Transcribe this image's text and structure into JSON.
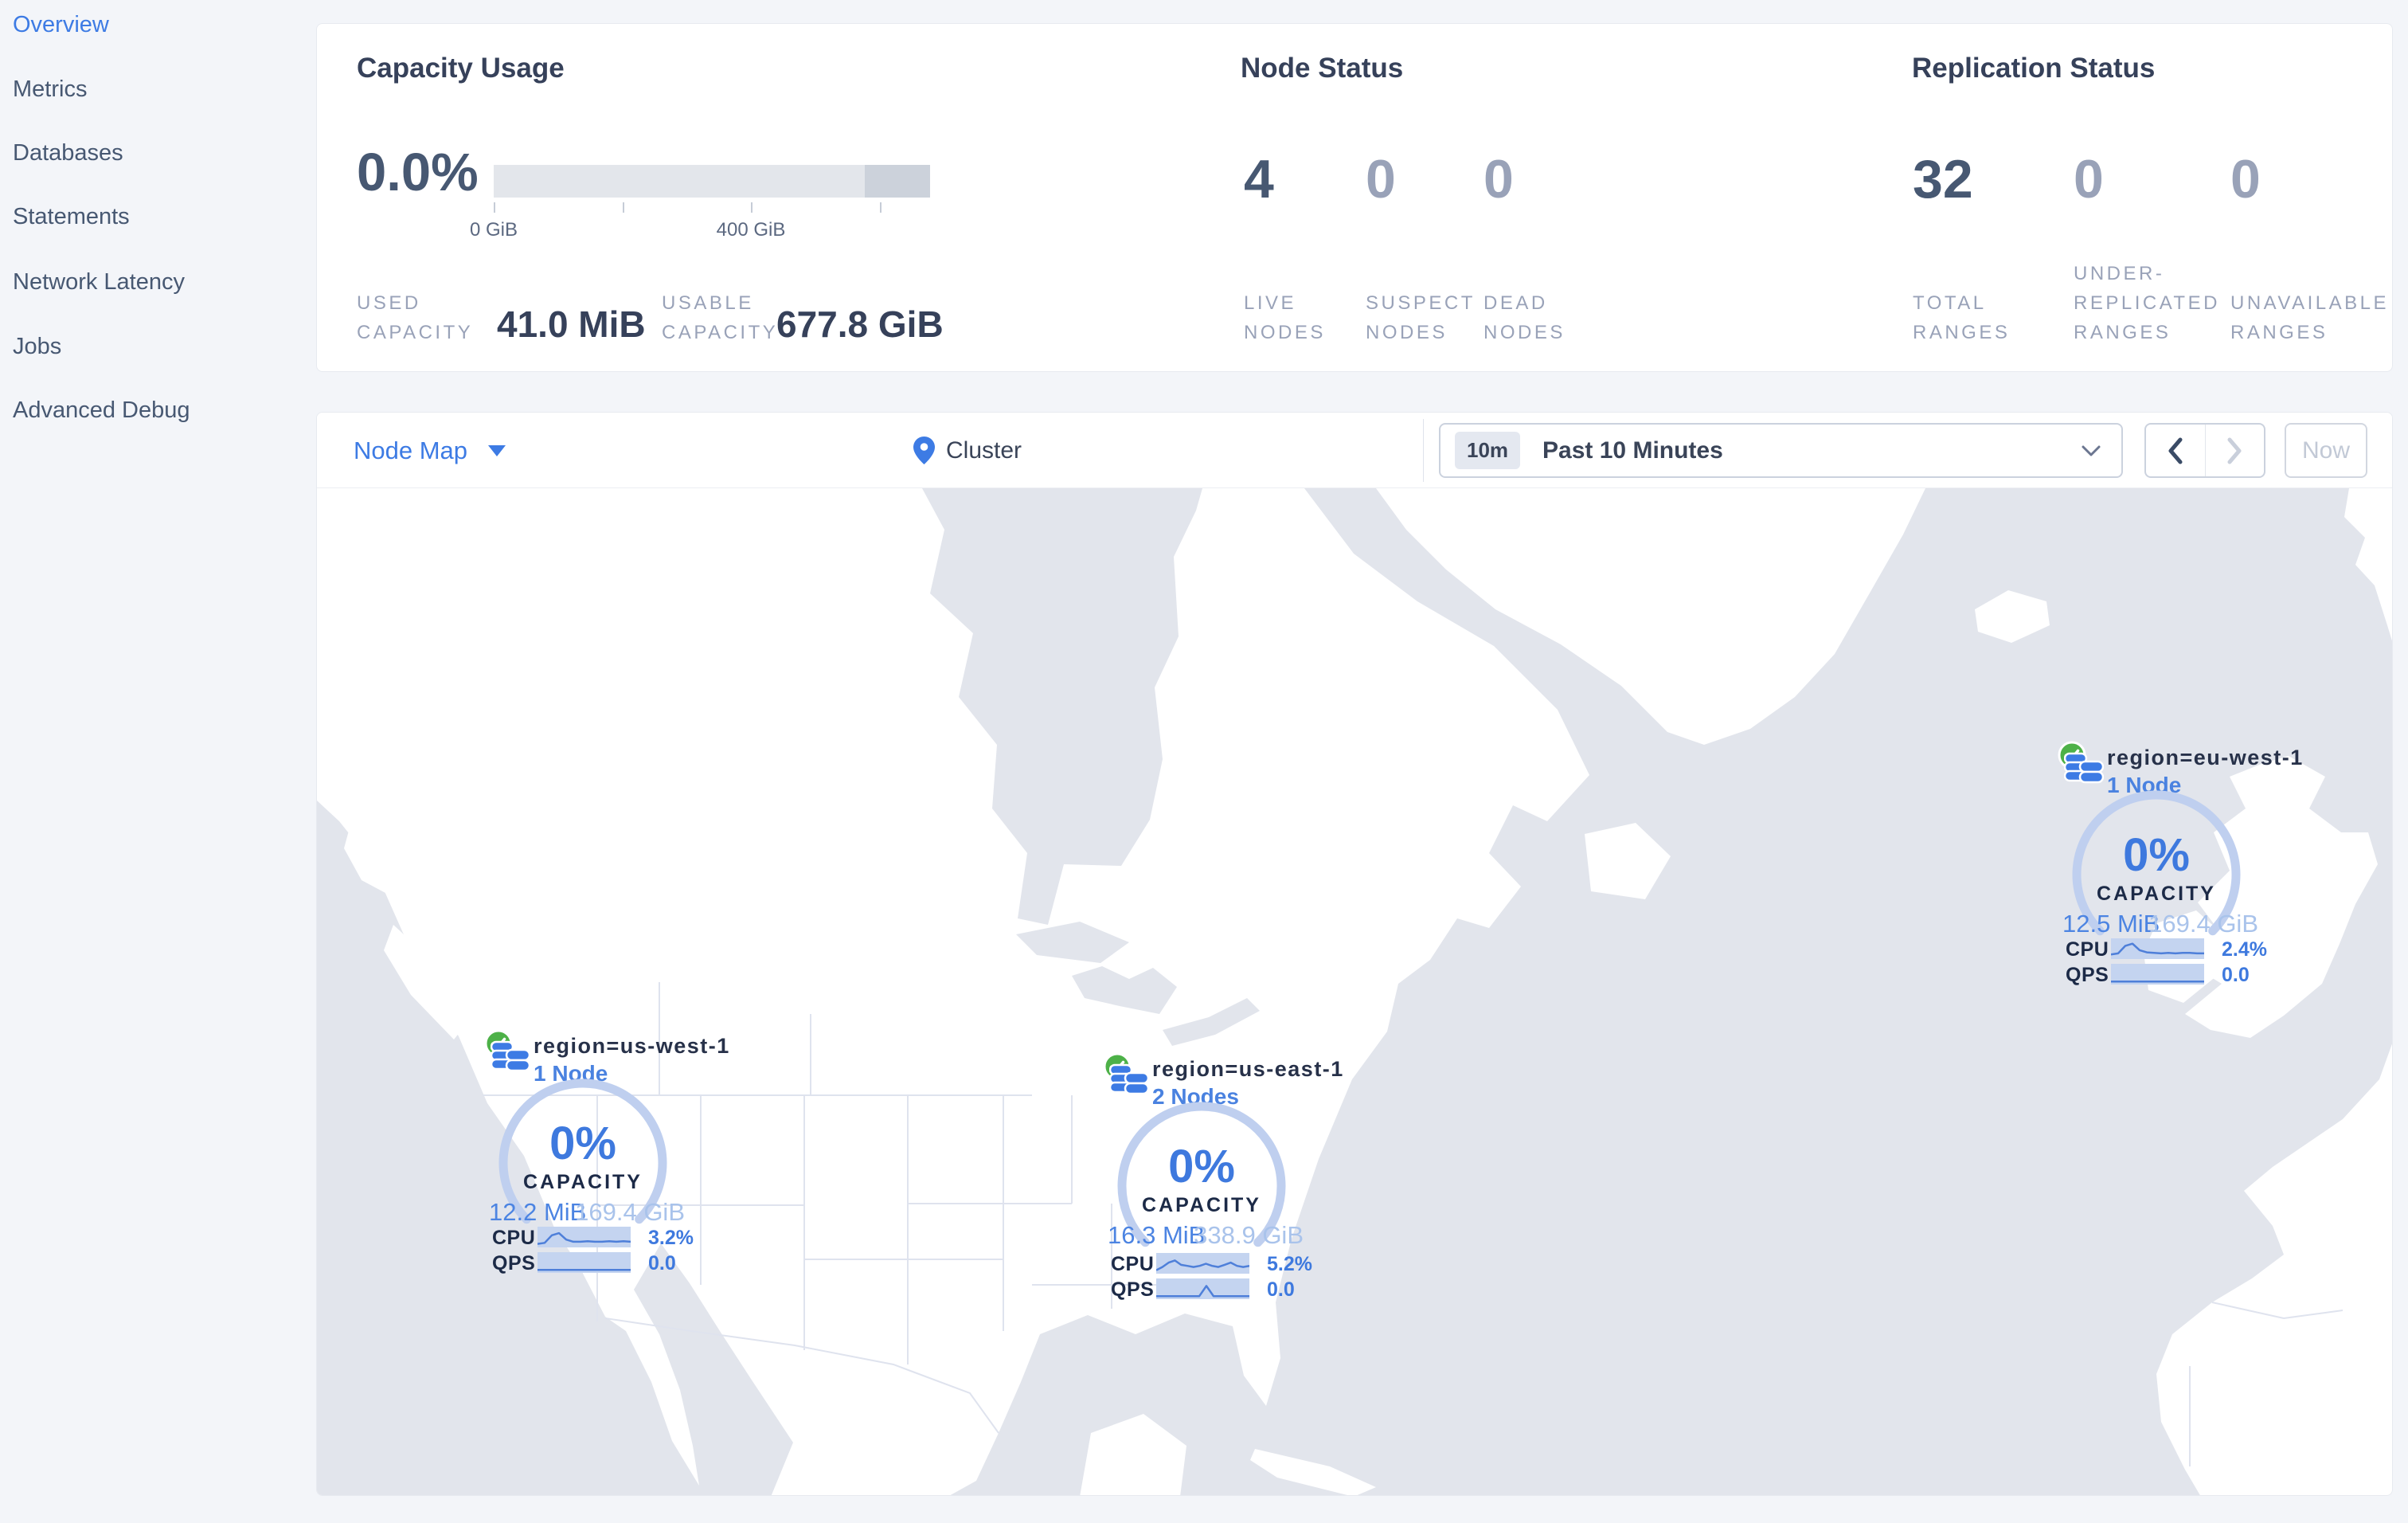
{
  "colors": {
    "accent_blue": "#3D7BE4",
    "gauge_blue": "#3E79DE",
    "slate": "#475872",
    "dim": "#99A2B8",
    "ocean": "#E2E5EC",
    "land": "#FFFFFF",
    "healthy_green": "#4DB148",
    "spark_bg": "#C4D4F0",
    "spark_line": "#4E7FD9"
  },
  "sidebar": {
    "items": [
      {
        "label": "Overview",
        "active": true
      },
      {
        "label": "Metrics",
        "active": false
      },
      {
        "label": "Databases",
        "active": false
      },
      {
        "label": "Statements",
        "active": false
      },
      {
        "label": "Network Latency",
        "active": false
      },
      {
        "label": "Jobs",
        "active": false
      },
      {
        "label": "Advanced Debug",
        "active": false
      }
    ]
  },
  "summary": {
    "capacity": {
      "title": "Capacity Usage",
      "percent": "0.0%",
      "tick_labels": [
        "0 GiB",
        "400 GiB"
      ],
      "stats": [
        {
          "label": "USED\nCAPACITY",
          "value": "41.0 MiB"
        },
        {
          "label": "USABLE\nCAPACITY",
          "value": "677.8 GiB"
        }
      ]
    },
    "nodes": {
      "title": "Node Status",
      "stats": [
        {
          "value": "4",
          "label": "LIVE\nNODES"
        },
        {
          "value": "0",
          "label": "SUSPECT\nNODES"
        },
        {
          "value": "0",
          "label": "DEAD\nNODES"
        }
      ]
    },
    "replication": {
      "title": "Replication Status",
      "stats": [
        {
          "value": "32",
          "label": "TOTAL\nRANGES"
        },
        {
          "value": "0",
          "label": "UNDER-\nREPLICATED\nRANGES"
        },
        {
          "value": "0",
          "label": "UNAVAILABLE\nRANGES"
        }
      ]
    }
  },
  "toolbar": {
    "view_label": "Node Map",
    "breadcrumb": "Cluster",
    "range_badge": "10m",
    "range_label": "Past 10 Minutes",
    "prev_label": "‹",
    "next_label": "›",
    "now_label": "Now"
  },
  "map_regions": [
    {
      "name": "region=us-west-1",
      "nodes_label": "1 Node",
      "capacity_percent": "0%",
      "capacity_label": "CAPACITY",
      "used": "12.2 MiB",
      "usable": "169.4 GiB",
      "cpu_label": "CPU",
      "cpu_value": "3.2%",
      "qps_label": "QPS",
      "qps_value": "0.0",
      "cpu_spark": [
        1,
        2,
        9,
        11,
        5,
        3,
        3,
        3.5,
        3,
        3,
        3.5,
        3,
        3.5,
        3
      ],
      "qps_spark": [
        0.5,
        0.5,
        0.5,
        0.5,
        0.5,
        0.5,
        0.5,
        0.5,
        0.5,
        0.5,
        0.5,
        0.5,
        0.5,
        0.5
      ]
    },
    {
      "name": "region=us-east-1",
      "nodes_label": "2 Nodes",
      "capacity_percent": "0%",
      "capacity_label": "CAPACITY",
      "used": "16.3 MiB",
      "usable": "338.9 GiB",
      "cpu_label": "CPU",
      "cpu_value": "5.2%",
      "qps_label": "QPS",
      "qps_value": "0.0",
      "cpu_spark": [
        1,
        4,
        8,
        10,
        6,
        5,
        4,
        5,
        7,
        5,
        4,
        6,
        8,
        5,
        4,
        5
      ],
      "qps_spark": [
        0.5,
        0.5,
        0.5,
        0.5,
        0.5,
        0.5,
        0.5,
        10,
        0.5,
        0.5,
        0.5,
        0.5,
        0.5,
        0.5
      ]
    },
    {
      "name": "region=eu-west-1",
      "nodes_label": "1 Node",
      "capacity_percent": "0%",
      "capacity_label": "CAPACITY",
      "used": "12.5 MiB",
      "usable": "169.4 GiB",
      "cpu_label": "CPU",
      "cpu_value": "2.4%",
      "qps_label": "QPS",
      "qps_value": "0.0",
      "cpu_spark": [
        2,
        3,
        10,
        12,
        6,
        4,
        3.5,
        3,
        3.5,
        3,
        3.5,
        3.5,
        3,
        3
      ],
      "qps_spark": [
        0.5,
        0.5,
        0.5,
        0.5,
        0.5,
        0.5,
        0.5,
        0.5,
        0.5,
        0.5,
        0.5,
        0.5,
        0.5,
        0.5
      ]
    }
  ]
}
